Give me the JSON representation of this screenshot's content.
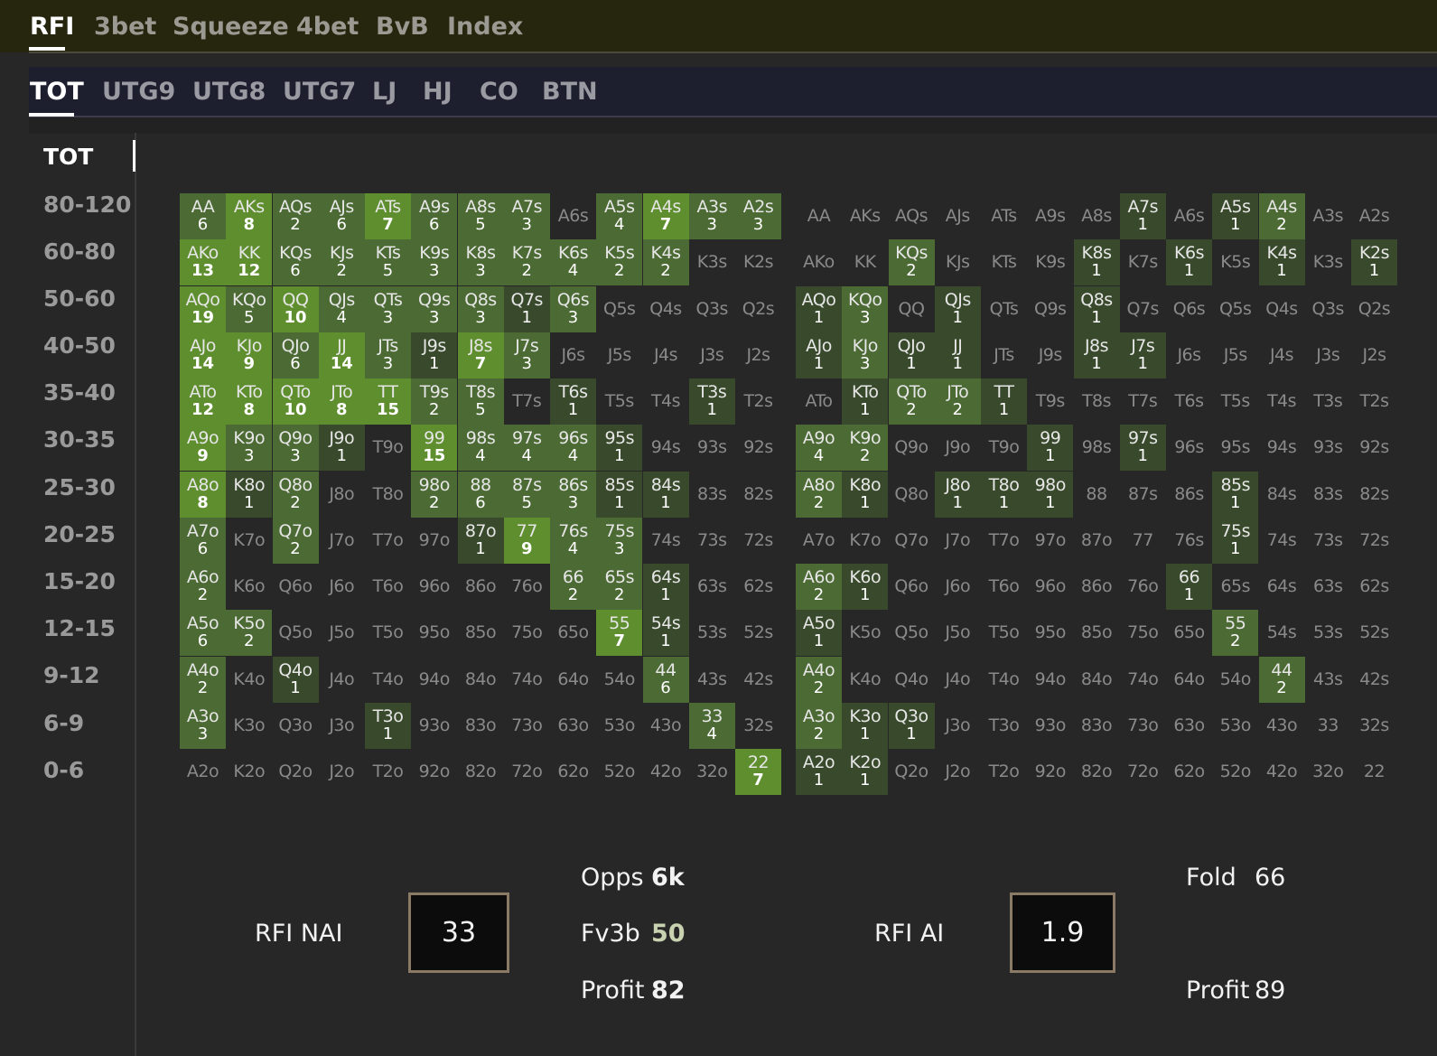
{
  "tabs": [
    "RFI",
    "3bet",
    "Squeeze",
    "4bet",
    "BvB",
    "Index"
  ],
  "positions": [
    "TOT",
    "UTG9",
    "UTG8",
    "UTG7",
    "LJ",
    "HJ",
    "CO",
    "BTN"
  ],
  "stack_ranges": [
    "TOT",
    "80-120",
    "60-80",
    "50-60",
    "40-50",
    "35-40",
    "30-35",
    "25-30",
    "20-25",
    "15-20",
    "12-15",
    "9-12",
    "6-9",
    "0-6"
  ],
  "grids": {
    "nai": [
      [
        [
          "AA",
          "6"
        ],
        [
          "AKs",
          "8"
        ],
        [
          "AQs",
          "2"
        ],
        [
          "AJs",
          "6"
        ],
        [
          "ATs",
          "7"
        ],
        [
          "A9s",
          "6"
        ],
        [
          "A8s",
          "5"
        ],
        [
          "A7s",
          "3"
        ],
        [
          "A6s",
          ""
        ],
        [
          "A5s",
          "4"
        ],
        [
          "A4s",
          "7"
        ],
        [
          "A3s",
          "3"
        ],
        [
          "A2s",
          "3"
        ]
      ],
      [
        [
          "AKo",
          "13"
        ],
        [
          "KK",
          "12"
        ],
        [
          "KQs",
          "6"
        ],
        [
          "KJs",
          "2"
        ],
        [
          "KTs",
          "5"
        ],
        [
          "K9s",
          "3"
        ],
        [
          "K8s",
          "3"
        ],
        [
          "K7s",
          "2"
        ],
        [
          "K6s",
          "4"
        ],
        [
          "K5s",
          "2"
        ],
        [
          "K4s",
          "2"
        ],
        [
          "K3s",
          ""
        ],
        [
          "K2s",
          ""
        ]
      ],
      [
        [
          "AQo",
          "19"
        ],
        [
          "KQo",
          "5"
        ],
        [
          "QQ",
          "10"
        ],
        [
          "QJs",
          "4"
        ],
        [
          "QTs",
          "3"
        ],
        [
          "Q9s",
          "3"
        ],
        [
          "Q8s",
          "3"
        ],
        [
          "Q7s",
          "1"
        ],
        [
          "Q6s",
          "3"
        ],
        [
          "Q5s",
          ""
        ],
        [
          "Q4s",
          ""
        ],
        [
          "Q3s",
          ""
        ],
        [
          "Q2s",
          ""
        ]
      ],
      [
        [
          "AJo",
          "14"
        ],
        [
          "KJo",
          "9"
        ],
        [
          "QJo",
          "6"
        ],
        [
          "JJ",
          "14"
        ],
        [
          "JTs",
          "3"
        ],
        [
          "J9s",
          "1"
        ],
        [
          "J8s",
          "7"
        ],
        [
          "J7s",
          "3"
        ],
        [
          "J6s",
          ""
        ],
        [
          "J5s",
          ""
        ],
        [
          "J4s",
          ""
        ],
        [
          "J3s",
          ""
        ],
        [
          "J2s",
          ""
        ]
      ],
      [
        [
          "ATo",
          "12"
        ],
        [
          "KTo",
          "8"
        ],
        [
          "QTo",
          "10"
        ],
        [
          "JTo",
          "8"
        ],
        [
          "TT",
          "15"
        ],
        [
          "T9s",
          "2"
        ],
        [
          "T8s",
          "5"
        ],
        [
          "T7s",
          ""
        ],
        [
          "T6s",
          "1"
        ],
        [
          "T5s",
          ""
        ],
        [
          "T4s",
          ""
        ],
        [
          "T3s",
          "1"
        ],
        [
          "T2s",
          ""
        ]
      ],
      [
        [
          "A9o",
          "9"
        ],
        [
          "K9o",
          "3"
        ],
        [
          "Q9o",
          "3"
        ],
        [
          "J9o",
          "1"
        ],
        [
          "T9o",
          ""
        ],
        [
          "99",
          "15"
        ],
        [
          "98s",
          "4"
        ],
        [
          "97s",
          "4"
        ],
        [
          "96s",
          "4"
        ],
        [
          "95s",
          "1"
        ],
        [
          "94s",
          ""
        ],
        [
          "93s",
          ""
        ],
        [
          "92s",
          ""
        ]
      ],
      [
        [
          "A8o",
          "8"
        ],
        [
          "K8o",
          "1"
        ],
        [
          "Q8o",
          "2"
        ],
        [
          "J8o",
          ""
        ],
        [
          "T8o",
          ""
        ],
        [
          "98o",
          "2"
        ],
        [
          "88",
          "6"
        ],
        [
          "87s",
          "5"
        ],
        [
          "86s",
          "3"
        ],
        [
          "85s",
          "1"
        ],
        [
          "84s",
          "1"
        ],
        [
          "83s",
          ""
        ],
        [
          "82s",
          ""
        ]
      ],
      [
        [
          "A7o",
          "6"
        ],
        [
          "K7o",
          ""
        ],
        [
          "Q7o",
          "2"
        ],
        [
          "J7o",
          ""
        ],
        [
          "T7o",
          ""
        ],
        [
          "97o",
          ""
        ],
        [
          "87o",
          "1"
        ],
        [
          "77",
          "9"
        ],
        [
          "76s",
          "4"
        ],
        [
          "75s",
          "3"
        ],
        [
          "74s",
          ""
        ],
        [
          "73s",
          ""
        ],
        [
          "72s",
          ""
        ]
      ],
      [
        [
          "A6o",
          "2"
        ],
        [
          "K6o",
          ""
        ],
        [
          "Q6o",
          ""
        ],
        [
          "J6o",
          ""
        ],
        [
          "T6o",
          ""
        ],
        [
          "96o",
          ""
        ],
        [
          "86o",
          ""
        ],
        [
          "76o",
          ""
        ],
        [
          "66",
          "2"
        ],
        [
          "65s",
          "2"
        ],
        [
          "64s",
          "1"
        ],
        [
          "63s",
          ""
        ],
        [
          "62s",
          ""
        ]
      ],
      [
        [
          "A5o",
          "6"
        ],
        [
          "K5o",
          "2"
        ],
        [
          "Q5o",
          ""
        ],
        [
          "J5o",
          ""
        ],
        [
          "T5o",
          ""
        ],
        [
          "95o",
          ""
        ],
        [
          "85o",
          ""
        ],
        [
          "75o",
          ""
        ],
        [
          "65o",
          ""
        ],
        [
          "55",
          "7"
        ],
        [
          "54s",
          "1"
        ],
        [
          "53s",
          ""
        ],
        [
          "52s",
          ""
        ]
      ],
      [
        [
          "A4o",
          "2"
        ],
        [
          "K4o",
          ""
        ],
        [
          "Q4o",
          "1"
        ],
        [
          "J4o",
          ""
        ],
        [
          "T4o",
          ""
        ],
        [
          "94o",
          ""
        ],
        [
          "84o",
          ""
        ],
        [
          "74o",
          ""
        ],
        [
          "64o",
          ""
        ],
        [
          "54o",
          ""
        ],
        [
          "44",
          "6"
        ],
        [
          "43s",
          ""
        ],
        [
          "42s",
          ""
        ]
      ],
      [
        [
          "A3o",
          "3"
        ],
        [
          "K3o",
          ""
        ],
        [
          "Q3o",
          ""
        ],
        [
          "J3o",
          ""
        ],
        [
          "T3o",
          "1"
        ],
        [
          "93o",
          ""
        ],
        [
          "83o",
          ""
        ],
        [
          "73o",
          ""
        ],
        [
          "63o",
          ""
        ],
        [
          "53o",
          ""
        ],
        [
          "43o",
          ""
        ],
        [
          "33",
          "4"
        ],
        [
          "32s",
          ""
        ]
      ],
      [
        [
          "A2o",
          ""
        ],
        [
          "K2o",
          ""
        ],
        [
          "Q2o",
          ""
        ],
        [
          "J2o",
          ""
        ],
        [
          "T2o",
          ""
        ],
        [
          "92o",
          ""
        ],
        [
          "82o",
          ""
        ],
        [
          "72o",
          ""
        ],
        [
          "62o",
          ""
        ],
        [
          "52o",
          ""
        ],
        [
          "42o",
          ""
        ],
        [
          "32o",
          ""
        ],
        [
          "22",
          "7"
        ]
      ]
    ],
    "ai": [
      [
        [
          "AA",
          ""
        ],
        [
          "AKs",
          ""
        ],
        [
          "AQs",
          ""
        ],
        [
          "AJs",
          ""
        ],
        [
          "ATs",
          ""
        ],
        [
          "A9s",
          ""
        ],
        [
          "A8s",
          ""
        ],
        [
          "A7s",
          "1"
        ],
        [
          "A6s",
          ""
        ],
        [
          "A5s",
          "1"
        ],
        [
          "A4s",
          "2"
        ],
        [
          "A3s",
          ""
        ],
        [
          "A2s",
          ""
        ]
      ],
      [
        [
          "AKo",
          ""
        ],
        [
          "KK",
          ""
        ],
        [
          "KQs",
          "2"
        ],
        [
          "KJs",
          ""
        ],
        [
          "KTs",
          ""
        ],
        [
          "K9s",
          ""
        ],
        [
          "K8s",
          "1"
        ],
        [
          "K7s",
          ""
        ],
        [
          "K6s",
          "1"
        ],
        [
          "K5s",
          ""
        ],
        [
          "K4s",
          "1"
        ],
        [
          "K3s",
          ""
        ],
        [
          "K2s",
          "1"
        ]
      ],
      [
        [
          "AQo",
          "1"
        ],
        [
          "KQo",
          "3"
        ],
        [
          "QQ",
          ""
        ],
        [
          "QJs",
          "1"
        ],
        [
          "QTs",
          ""
        ],
        [
          "Q9s",
          ""
        ],
        [
          "Q8s",
          "1"
        ],
        [
          "Q7s",
          ""
        ],
        [
          "Q6s",
          ""
        ],
        [
          "Q5s",
          ""
        ],
        [
          "Q4s",
          ""
        ],
        [
          "Q3s",
          ""
        ],
        [
          "Q2s",
          ""
        ]
      ],
      [
        [
          "AJo",
          "1"
        ],
        [
          "KJo",
          "3"
        ],
        [
          "QJo",
          "1"
        ],
        [
          "JJ",
          "1"
        ],
        [
          "JTs",
          ""
        ],
        [
          "J9s",
          ""
        ],
        [
          "J8s",
          "1"
        ],
        [
          "J7s",
          "1"
        ],
        [
          "J6s",
          ""
        ],
        [
          "J5s",
          ""
        ],
        [
          "J4s",
          ""
        ],
        [
          "J3s",
          ""
        ],
        [
          "J2s",
          ""
        ]
      ],
      [
        [
          "ATo",
          ""
        ],
        [
          "KTo",
          "1"
        ],
        [
          "QTo",
          "2"
        ],
        [
          "JTo",
          "2"
        ],
        [
          "TT",
          "1"
        ],
        [
          "T9s",
          ""
        ],
        [
          "T8s",
          ""
        ],
        [
          "T7s",
          ""
        ],
        [
          "T6s",
          ""
        ],
        [
          "T5s",
          ""
        ],
        [
          "T4s",
          ""
        ],
        [
          "T3s",
          ""
        ],
        [
          "T2s",
          ""
        ]
      ],
      [
        [
          "A9o",
          "4"
        ],
        [
          "K9o",
          "2"
        ],
        [
          "Q9o",
          ""
        ],
        [
          "J9o",
          ""
        ],
        [
          "T9o",
          ""
        ],
        [
          "99",
          "1"
        ],
        [
          "98s",
          ""
        ],
        [
          "97s",
          "1"
        ],
        [
          "96s",
          ""
        ],
        [
          "95s",
          ""
        ],
        [
          "94s",
          ""
        ],
        [
          "93s",
          ""
        ],
        [
          "92s",
          ""
        ]
      ],
      [
        [
          "A8o",
          "2"
        ],
        [
          "K8o",
          "1"
        ],
        [
          "Q8o",
          ""
        ],
        [
          "J8o",
          "1"
        ],
        [
          "T8o",
          "1"
        ],
        [
          "98o",
          "1"
        ],
        [
          "88",
          ""
        ],
        [
          "87s",
          ""
        ],
        [
          "86s",
          ""
        ],
        [
          "85s",
          "1"
        ],
        [
          "84s",
          ""
        ],
        [
          "83s",
          ""
        ],
        [
          "82s",
          ""
        ]
      ],
      [
        [
          "A7o",
          ""
        ],
        [
          "K7o",
          ""
        ],
        [
          "Q7o",
          ""
        ],
        [
          "J7o",
          ""
        ],
        [
          "T7o",
          ""
        ],
        [
          "97o",
          ""
        ],
        [
          "87o",
          ""
        ],
        [
          "77",
          ""
        ],
        [
          "76s",
          ""
        ],
        [
          "75s",
          "1"
        ],
        [
          "74s",
          ""
        ],
        [
          "73s",
          ""
        ],
        [
          "72s",
          ""
        ]
      ],
      [
        [
          "A6o",
          "2"
        ],
        [
          "K6o",
          "1"
        ],
        [
          "Q6o",
          ""
        ],
        [
          "J6o",
          ""
        ],
        [
          "T6o",
          ""
        ],
        [
          "96o",
          ""
        ],
        [
          "86o",
          ""
        ],
        [
          "76o",
          ""
        ],
        [
          "66",
          "1"
        ],
        [
          "65s",
          ""
        ],
        [
          "64s",
          ""
        ],
        [
          "63s",
          ""
        ],
        [
          "62s",
          ""
        ]
      ],
      [
        [
          "A5o",
          "1"
        ],
        [
          "K5o",
          ""
        ],
        [
          "Q5o",
          ""
        ],
        [
          "J5o",
          ""
        ],
        [
          "T5o",
          ""
        ],
        [
          "95o",
          ""
        ],
        [
          "85o",
          ""
        ],
        [
          "75o",
          ""
        ],
        [
          "65o",
          ""
        ],
        [
          "55",
          "2"
        ],
        [
          "54s",
          ""
        ],
        [
          "53s",
          ""
        ],
        [
          "52s",
          ""
        ]
      ],
      [
        [
          "A4o",
          "2"
        ],
        [
          "K4o",
          ""
        ],
        [
          "Q4o",
          ""
        ],
        [
          "J4o",
          ""
        ],
        [
          "T4o",
          ""
        ],
        [
          "94o",
          ""
        ],
        [
          "84o",
          ""
        ],
        [
          "74o",
          ""
        ],
        [
          "64o",
          ""
        ],
        [
          "54o",
          ""
        ],
        [
          "44",
          "2"
        ],
        [
          "43s",
          ""
        ],
        [
          "42s",
          ""
        ]
      ],
      [
        [
          "A3o",
          "2"
        ],
        [
          "K3o",
          "1"
        ],
        [
          "Q3o",
          "1"
        ],
        [
          "J3o",
          ""
        ],
        [
          "T3o",
          ""
        ],
        [
          "93o",
          ""
        ],
        [
          "83o",
          ""
        ],
        [
          "73o",
          ""
        ],
        [
          "63o",
          ""
        ],
        [
          "53o",
          ""
        ],
        [
          "43o",
          ""
        ],
        [
          "33",
          ""
        ],
        [
          "32s",
          ""
        ]
      ],
      [
        [
          "A2o",
          "1"
        ],
        [
          "K2o",
          "1"
        ],
        [
          "Q2o",
          ""
        ],
        [
          "J2o",
          ""
        ],
        [
          "T2o",
          ""
        ],
        [
          "92o",
          ""
        ],
        [
          "82o",
          ""
        ],
        [
          "72o",
          ""
        ],
        [
          "62o",
          ""
        ],
        [
          "52o",
          ""
        ],
        [
          "42o",
          ""
        ],
        [
          "32o",
          ""
        ],
        [
          "22",
          ""
        ]
      ]
    ]
  },
  "stats": {
    "nai_label": "RFI NAI",
    "nai_value": "33",
    "opps_label": "Opps",
    "opps_value": "6k",
    "fv3b_label": "Fv3b",
    "fv3b_value": "50",
    "profit_label": "Profit",
    "profit_nai_value": "82",
    "ai_label": "RFI AI",
    "ai_value": "1.9",
    "fold_label": "Fold",
    "fold_value": "66",
    "profit_ai_value": "89"
  },
  "colors": {
    "cell_dark": "#394a2c",
    "cell_mid": "#4c6a34",
    "cell_bright": "#5e8e2e",
    "cell_empty_bg": "#2e2e2e",
    "text_muted": "#8a8a8a"
  }
}
